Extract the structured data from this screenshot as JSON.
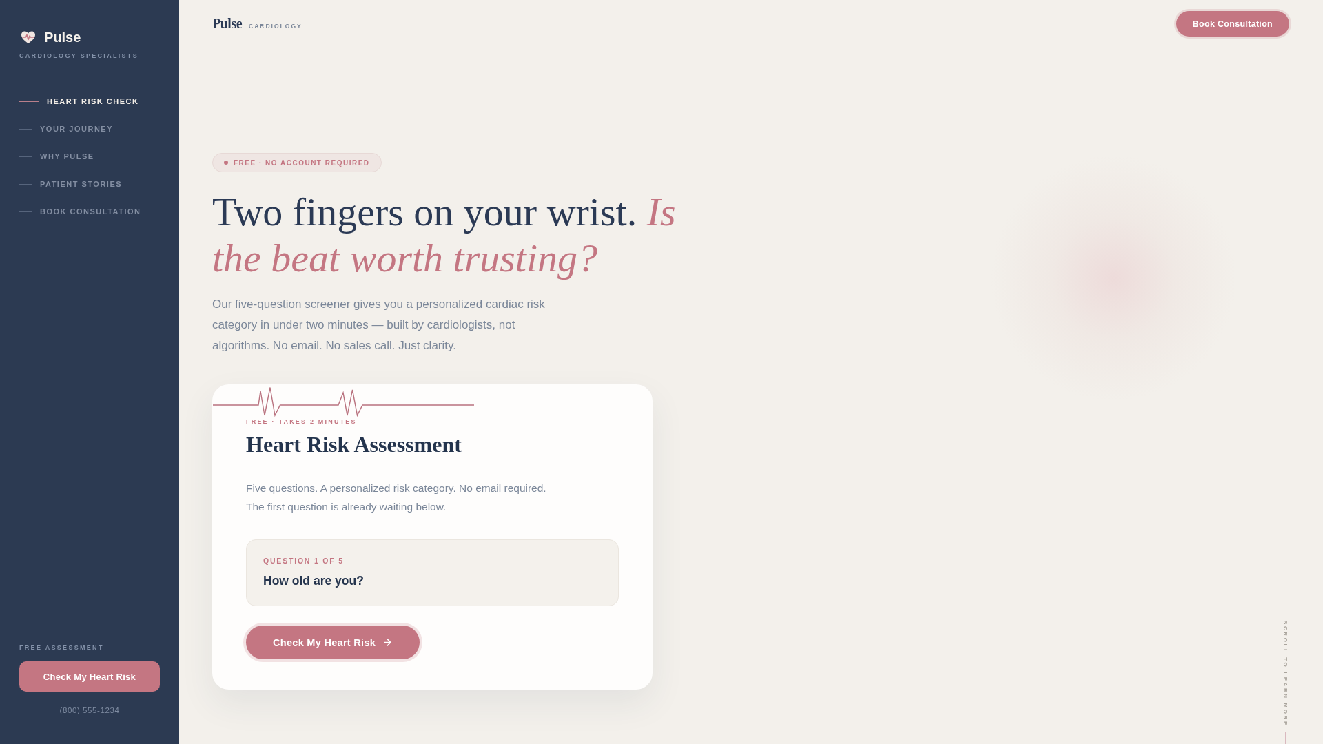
{
  "sidebar": {
    "brand": "Pulse",
    "tagline": "CARDIOLOGY SPECIALISTS",
    "nav": [
      {
        "label": "HEART RISK CHECK",
        "selected": true
      },
      {
        "label": "YOUR JOURNEY",
        "selected": false
      },
      {
        "label": "WHY PULSE",
        "selected": false
      },
      {
        "label": "PATIENT STORIES",
        "selected": false
      },
      {
        "label": "BOOK CONSULTATION",
        "selected": false
      }
    ],
    "cta_label": "FREE ASSESSMENT",
    "cta_button": "Check My Heart Risk",
    "phone": "(800) 555-1234"
  },
  "header": {
    "brand": "Pulse",
    "subtitle": "CARDIOLOGY",
    "button": "Book Consultation"
  },
  "hero": {
    "badge": "FREE · NO ACCOUNT REQUIRED",
    "title": "Two fingers on your wrist. *Is the beat worth trusting?*",
    "lead": "Our five-question screener gives you a personalized cardiac risk category in under two minutes — built by cardiologists, not algorithms. No email. No sales call. Just clarity."
  },
  "card": {
    "eyebrow": "FREE · TAKES 2 MINUTES",
    "title": "Heart Risk Assessment",
    "text": "Five questions. A personalized risk category. No email required. The first question is already waiting below.",
    "question": {
      "label": "QUESTION 1 OF 5",
      "text": "How old are you?"
    },
    "button": "Check My Heart Risk"
  },
  "scroll_hint": "SCROLL TO LEARN MORE"
}
